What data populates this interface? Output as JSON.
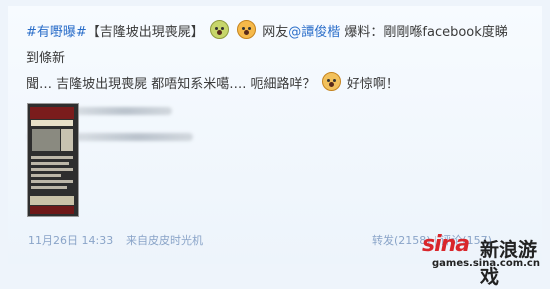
{
  "post": {
    "topic": "#有嘢曝#",
    "headline": "【吉隆坡出現喪屍】",
    "user_prefix": "网友",
    "mention": "@譚俊楷",
    "after_mention": " 爆料：剛剛喺facebook度睇到條新",
    "line2_part1": "聞… 吉隆坡出現喪屍 都唔知系米噶…. 呃細路咩？",
    "line2_part2": " 好惊啊！"
  },
  "meta": {
    "timestamp": "11月26日 14:33",
    "source": "来自皮皮时光机",
    "repost": "转发(2158)",
    "sep": "|",
    "comment": "评论(157)"
  },
  "logo": {
    "brand": "sina",
    "name": "新浪游戏",
    "url": "games.sina.com.cn"
  },
  "icons": {
    "emoji1": "sick-face-icon",
    "emoji2": "shocked-face-icon",
    "emoji3": "shocked-face-icon"
  }
}
